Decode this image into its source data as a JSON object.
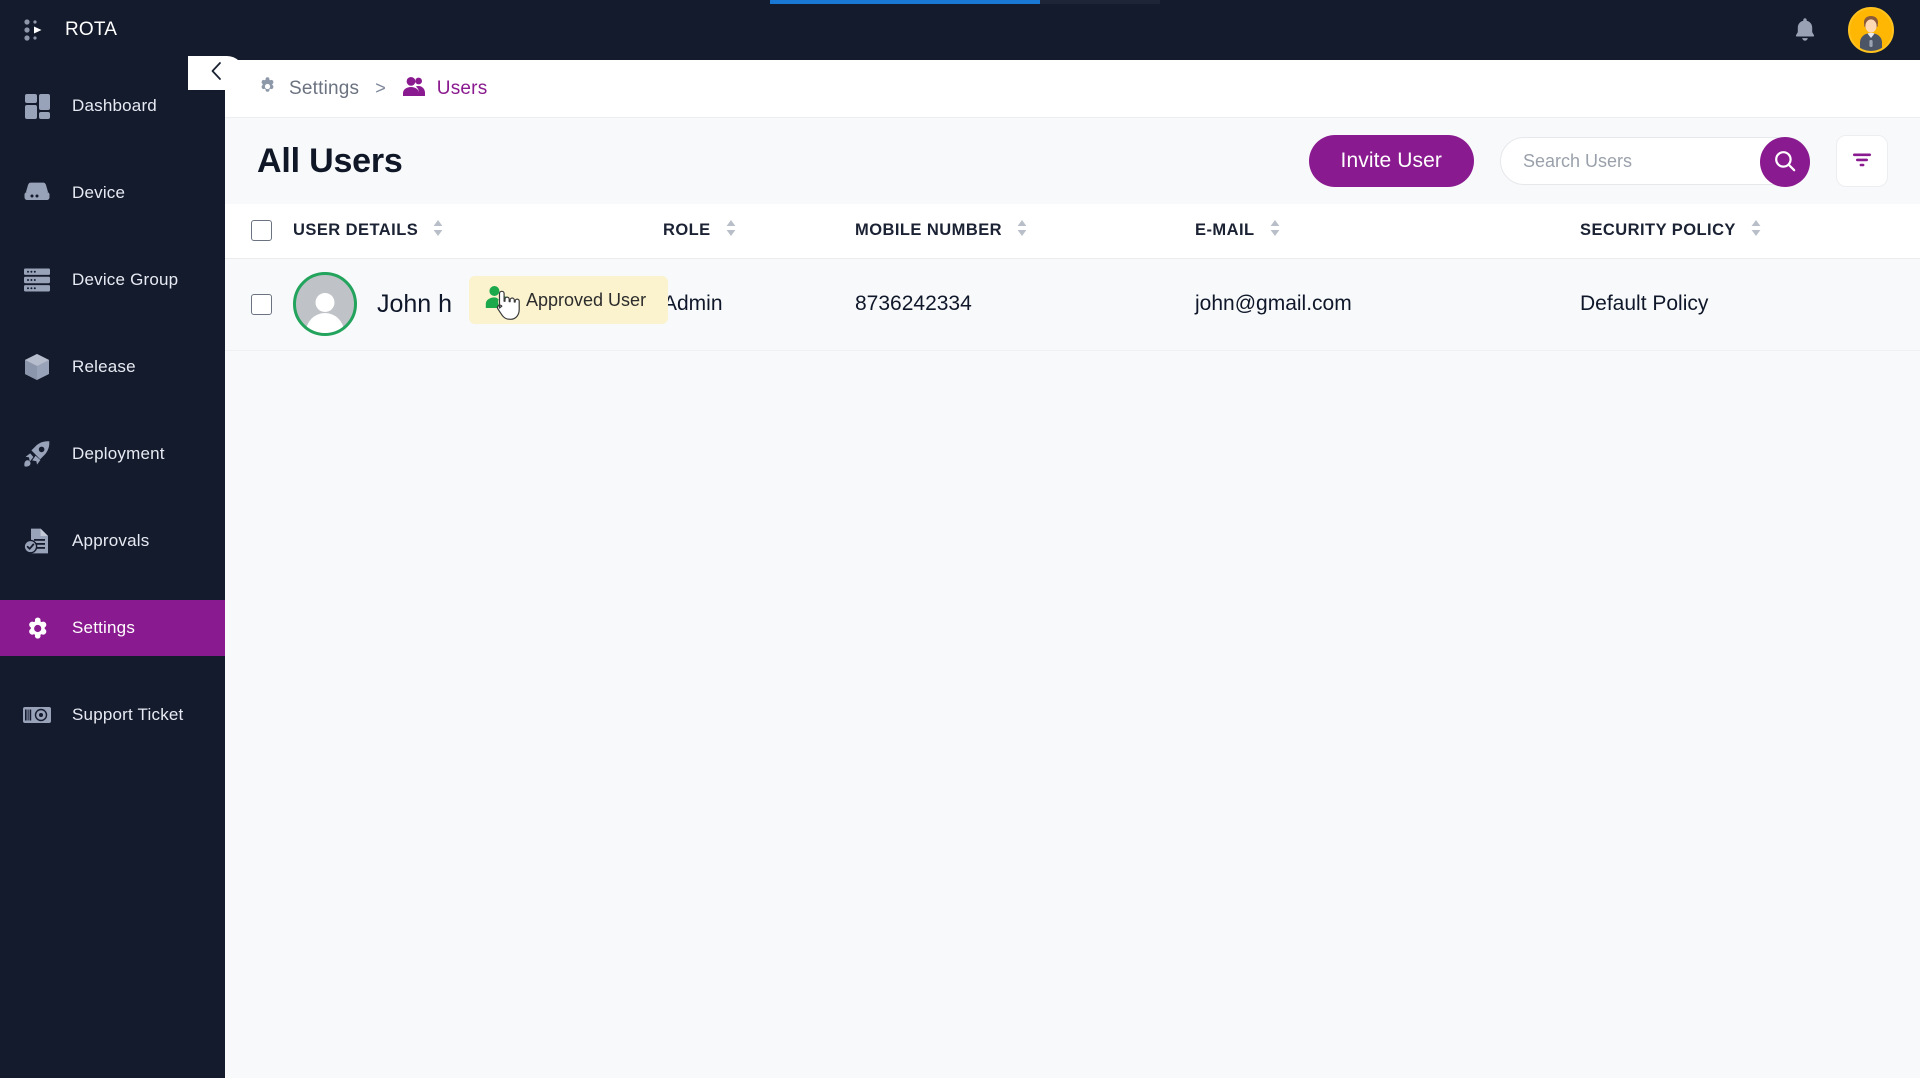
{
  "app": {
    "brand": "ROTA",
    "accent": "#8a1a8f",
    "sidebar_bg": "#141b2d",
    "progress_color": "#1878d4"
  },
  "topbar": {
    "notifications_icon": "bell-icon",
    "avatar_icon": "user-avatar"
  },
  "sidebar": {
    "collapse_icon": "chevron-left-icon",
    "items": [
      {
        "label": "Dashboard",
        "icon": "dashboard-icon",
        "active": false
      },
      {
        "label": "Device",
        "icon": "device-icon",
        "active": false
      },
      {
        "label": "Device Group",
        "icon": "device-group-icon",
        "active": false
      },
      {
        "label": "Release",
        "icon": "package-icon",
        "active": false
      },
      {
        "label": "Deployment",
        "icon": "rocket-icon",
        "active": false
      },
      {
        "label": "Approvals",
        "icon": "document-check-icon",
        "active": false
      },
      {
        "label": "Settings",
        "icon": "gear-icon",
        "active": true
      },
      {
        "label": "Support Ticket",
        "icon": "ticket-icon",
        "active": false
      }
    ]
  },
  "breadcrumb": {
    "parent": "Settings",
    "parent_icon": "gear-icon",
    "separator": ">",
    "current": "Users",
    "current_icon": "users-icon"
  },
  "page": {
    "title": "All Users",
    "invite_label": "Invite User",
    "search_placeholder": "Search Users",
    "search_value": "",
    "search_icon": "search-icon",
    "filter_icon": "filter-icon"
  },
  "table": {
    "columns": [
      {
        "label": "USER DETAILS",
        "sortable": true
      },
      {
        "label": "ROLE",
        "sortable": true
      },
      {
        "label": "MOBILE NUMBER",
        "sortable": true
      },
      {
        "label": "E-MAIL",
        "sortable": true
      },
      {
        "label": "SECURITY POLICY",
        "sortable": true
      }
    ],
    "rows": [
      {
        "selected": false,
        "name": "John h",
        "role": "Admin",
        "role_visible_tail": "in",
        "mobile": "8736242334",
        "email": "john@gmail.com",
        "policy": "Default Policy",
        "avatar_icon": "user-avatar",
        "avatar_ring_color": "#22a45d",
        "info_icon": "info-icon"
      }
    ]
  },
  "tooltip": {
    "text": "Approved User",
    "icon": "approved-user-icon",
    "bg": "#faf3ce",
    "icon_color": "#1ba94c"
  }
}
